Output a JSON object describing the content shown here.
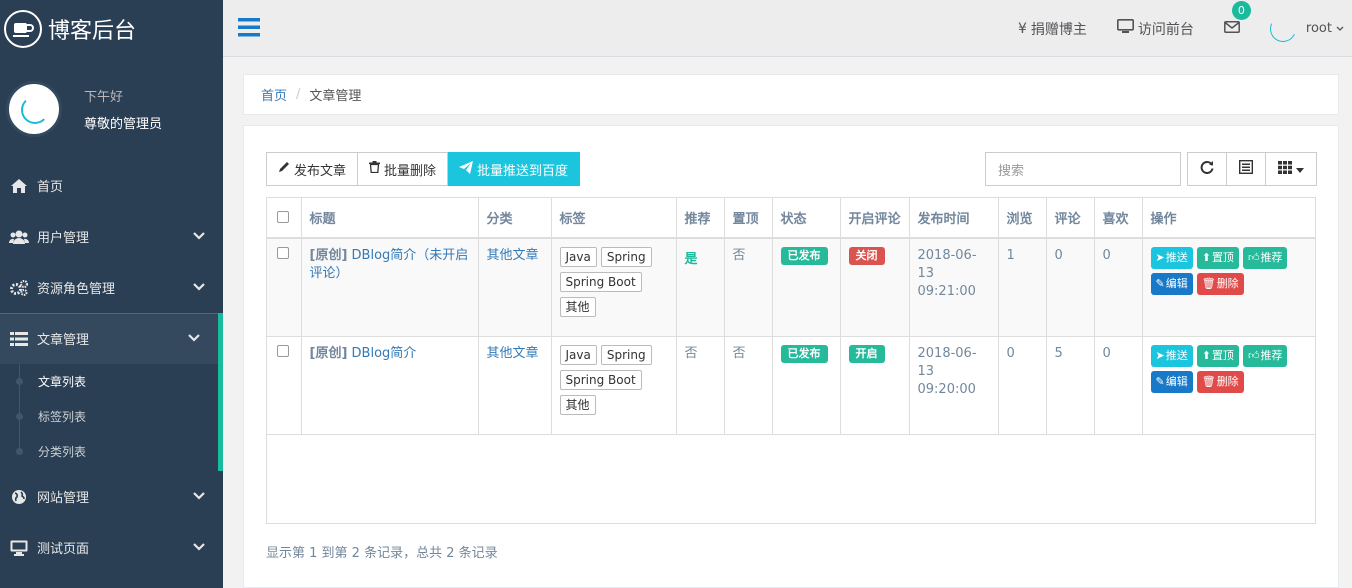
{
  "brand": {
    "title": "博客后台"
  },
  "profile": {
    "greeting": "下午好",
    "name": "尊敬的管理员"
  },
  "menu": [
    {
      "label": "首页",
      "icon": "home-icon"
    },
    {
      "label": "用户管理",
      "icon": "users-icon"
    },
    {
      "label": "资源角色管理",
      "icon": "cogs-icon"
    },
    {
      "label": "文章管理",
      "icon": "list-icon",
      "active": true
    },
    {
      "label": "网站管理",
      "icon": "globe-icon"
    },
    {
      "label": "测试页面",
      "icon": "desktop-icon"
    }
  ],
  "submenu": [
    {
      "label": "文章列表"
    },
    {
      "label": "标签列表"
    },
    {
      "label": "分类列表"
    }
  ],
  "topnav": {
    "donate": "捐赠博主",
    "visit": "访问前台",
    "mail_count": "0",
    "user": "root"
  },
  "breadcrumb": {
    "home": "首页",
    "current": "文章管理"
  },
  "toolbar": {
    "publish": "发布文章",
    "batch_delete": "批量删除",
    "batch_push": "批量推送到百度"
  },
  "search": {
    "placeholder": "搜索"
  },
  "table": {
    "headers": [
      "标题",
      "分类",
      "标签",
      "推荐",
      "置顶",
      "状态",
      "开启评论",
      "发布时间",
      "浏览",
      "评论",
      "喜欢",
      "操作"
    ],
    "rows": [
      {
        "prefix": "[原创]",
        "title": "DBlog简介（未开启评论）",
        "category": "其他文章",
        "tags": [
          "Java",
          "Spring",
          "Spring Boot",
          "其他"
        ],
        "recommend": "是",
        "top": "否",
        "status": "已发布",
        "comment": "关闭",
        "date": "2018-06-13",
        "time": "09:21:00",
        "views": "1",
        "comments": "0",
        "likes": "0"
      },
      {
        "prefix": "[原创]",
        "title": "DBlog简介",
        "category": "其他文章",
        "tags": [
          "Java",
          "Spring",
          "Spring Boot",
          "其他"
        ],
        "recommend": "否",
        "top": "否",
        "status": "已发布",
        "comment": "开启",
        "date": "2018-06-13",
        "time": "09:20:00",
        "views": "0",
        "comments": "5",
        "likes": "0"
      }
    ],
    "actions": {
      "push": "推送",
      "top": "置顶",
      "recommend": "推荐",
      "edit": "编辑",
      "delete": "删除"
    }
  },
  "pagination": {
    "info": "显示第 1 到第 2 条记录，总共 2 条记录"
  },
  "colors": {
    "sidebar": "#2a3f54",
    "accent": "#1abb9c",
    "info": "#1bc5dd",
    "danger": "#d9534f",
    "primary": "#1779c7"
  }
}
